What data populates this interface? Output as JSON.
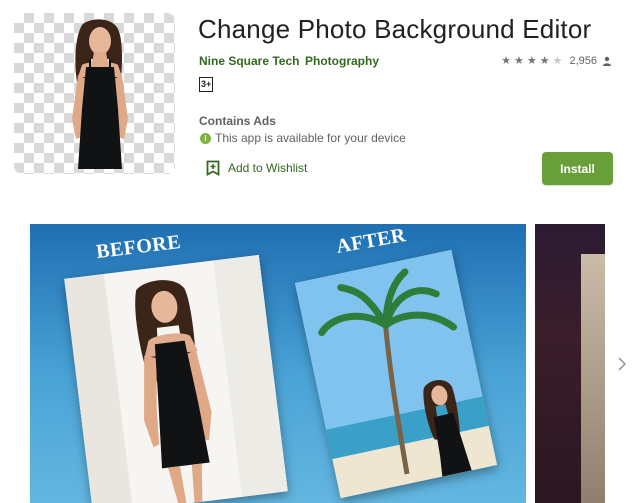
{
  "app": {
    "title": "Change Photo Background Editor",
    "developer": "Nine Square Tech",
    "category": "Photography",
    "rating_stars": 4,
    "rating_max": 5,
    "rating_count": "2,956",
    "age_rating": "3+",
    "contains_ads": "Contains Ads",
    "availability": "This app is available for your device",
    "wishlist_label": "Add to Wishlist",
    "install_label": "Install"
  },
  "screenshots": {
    "before_label": "BEFORE",
    "after_label": "AFTER"
  },
  "icons": {
    "info": "info-icon",
    "wishlist": "bookmark-add-icon",
    "rating_user": "person-icon",
    "next": "chevron-right-icon"
  },
  "colors": {
    "brand_green": "#689f38",
    "link_green": "#33691e",
    "info_green": "#7cb342",
    "screenshot_blue": "#1f6fb2"
  }
}
